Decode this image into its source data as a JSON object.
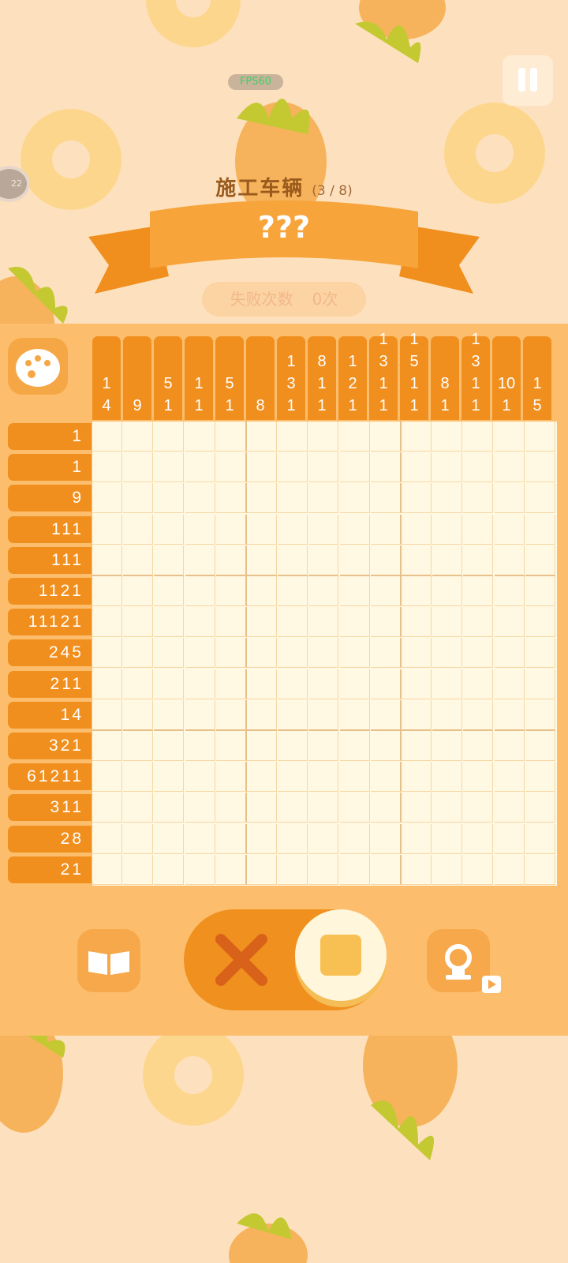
{
  "hud": {
    "fps": "FPS60",
    "badge": "22"
  },
  "level": {
    "title": "施工车辆",
    "progress": "(3 / 8)",
    "name": "???"
  },
  "fail": {
    "label": "失败次数",
    "value": "0次"
  },
  "colors": {
    "panel": "#fcbe6d",
    "clue": "#f18f1e",
    "grid": "#fff8e3",
    "background": "#fde1bf"
  },
  "column_clues": [
    [
      "1",
      "4"
    ],
    [
      "9"
    ],
    [
      "5",
      "1"
    ],
    [
      "1",
      "1"
    ],
    [
      "5",
      "1"
    ],
    [
      "8"
    ],
    [
      "1",
      "3",
      "1"
    ],
    [
      "8",
      "1",
      "1"
    ],
    [
      "1",
      "2",
      "1"
    ],
    [
      "1",
      "3",
      "1",
      "1"
    ],
    [
      "1",
      "5",
      "1",
      "1"
    ],
    [
      "8",
      "1"
    ],
    [
      "1",
      "3",
      "1",
      "1"
    ],
    [
      "10",
      "1"
    ],
    [
      "1",
      "5"
    ]
  ],
  "row_clues": [
    "1",
    "1",
    "9",
    "111",
    "111",
    "1121",
    "11121",
    "245",
    "211",
    "14",
    "321",
    "61211",
    "311",
    "28",
    "21"
  ],
  "grid": {
    "rows": 15,
    "cols": 15
  },
  "controls": {
    "book": "book-icon",
    "hint": "lightbulb-icon",
    "mode_cross": "cross-icon",
    "mode_fill": "square-icon"
  }
}
